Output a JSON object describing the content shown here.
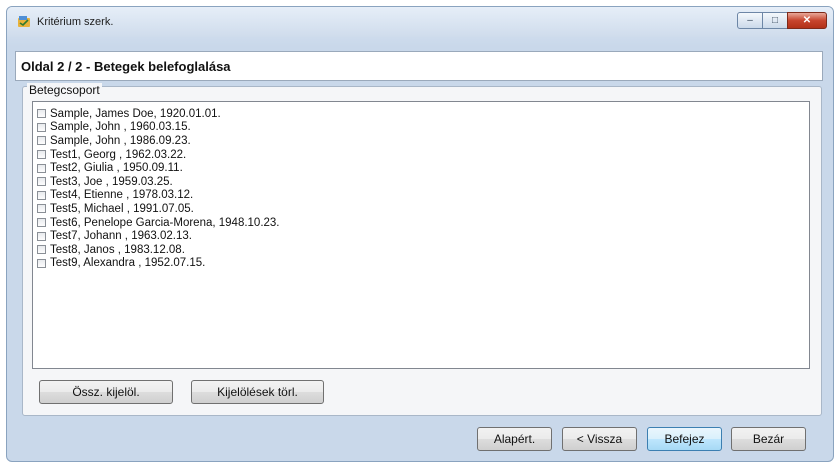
{
  "window": {
    "title": "Kritérium szerk.",
    "controls": {
      "minimize": "–",
      "maximize": "□",
      "close": "✕"
    }
  },
  "header": {
    "title": "Oldal 2 / 2 - Betegek belefoglalása"
  },
  "group": {
    "label": "Betegcsoport",
    "patients": [
      "Sample, James Doe, 1920.01.01.",
      "Sample, John , 1960.03.15.",
      "Sample, John , 1986.09.23.",
      "Test1, Georg , 1962.03.22.",
      "Test2, Giulia , 1950.09.11.",
      "Test3, Joe , 1959.03.25.",
      "Test4, Etienne , 1978.03.12.",
      "Test5, Michael , 1991.07.05.",
      "Test6, Penelope Garcia-Morena, 1948.10.23.",
      "Test7, Johann , 1963.02.13.",
      "Test8, Janos , 1983.12.08.",
      "Test9, Alexandra , 1952.07.15."
    ],
    "select_all_label": "Össz. kijelöl.",
    "clear_selection_label": "Kijelölések törl."
  },
  "footer": {
    "default_label": "Alapért.",
    "back_label": "< Vissza",
    "finish_label": "Befejez",
    "close_label": "Bezár"
  },
  "colors": {
    "frame_blue": "#c9d8ea",
    "close_red": "#c7452e",
    "default_button_blue": "#bee6fd"
  }
}
